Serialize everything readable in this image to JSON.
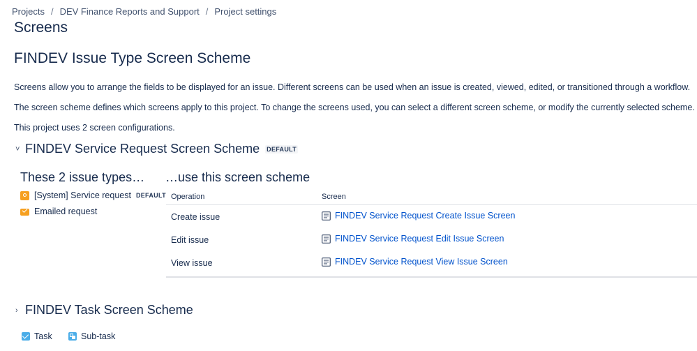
{
  "breadcrumb": {
    "items": [
      "Projects",
      "DEV Finance Reports and Support",
      "Project settings"
    ],
    "separator": "/"
  },
  "page_title": "Screens",
  "scheme_title": "FINDEV Issue Type Screen Scheme",
  "paragraphs": {
    "p1": "Screens allow you to arrange the fields to be displayed for an issue. Different screens can be used when an issue is created, viewed, edited, or transitioned through a workflow.",
    "p2": "The screen scheme defines which screens apply to this project. To change the screens used, you can select a different screen scheme, or modify the currently selected scheme.",
    "p3": "This project uses 2 screen configurations."
  },
  "sections": [
    {
      "title": "FINDEV Service Request Screen Scheme",
      "badge": "DEFAULT",
      "expanded": true,
      "issue_types_heading": "These 2 issue types…",
      "scheme_heading": "…use this screen scheme",
      "issue_types": [
        {
          "name": "[System] Service request",
          "badge": "DEFAULT",
          "icon": "service-request-icon"
        },
        {
          "name": "Emailed request",
          "icon": "email-icon"
        }
      ],
      "table": {
        "col_operation": "Operation",
        "col_screen": "Screen",
        "rows": [
          {
            "operation": "Create issue",
            "screen": "FINDEV Service Request Create Issue Screen"
          },
          {
            "operation": "Edit issue",
            "screen": "FINDEV Service Request Edit Issue Screen"
          },
          {
            "operation": "View issue",
            "screen": "FINDEV Service Request View Issue Screen"
          }
        ]
      }
    },
    {
      "title": "FINDEV Task Screen Scheme",
      "expanded": false,
      "issue_types": [
        {
          "name": "Task",
          "icon": "task-icon"
        },
        {
          "name": "Sub-task",
          "icon": "subtask-icon"
        }
      ]
    }
  ],
  "colors": {
    "link": "#0052cc",
    "text": "#172b4d",
    "issue_orange": "#f6a020",
    "issue_blue": "#4bade8",
    "divider": "#dfe1e6"
  }
}
